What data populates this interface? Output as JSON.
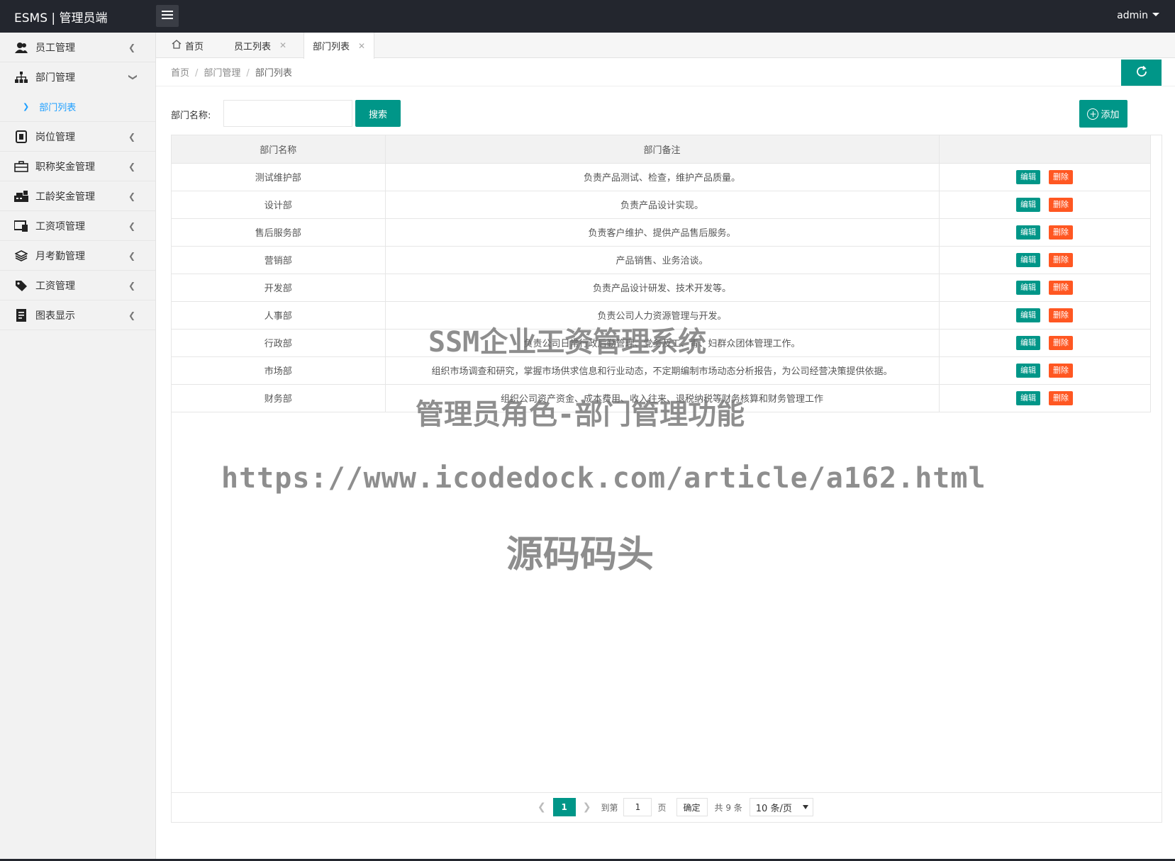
{
  "app": {
    "title": "ESMS | 管理员端",
    "user": "admin"
  },
  "sidebar": {
    "items": [
      {
        "label": "员工管理",
        "icon": "users-icon"
      },
      {
        "label": "部门管理",
        "icon": "org-tree-icon",
        "expanded": true,
        "children": [
          {
            "label": "部门列表",
            "active": true
          }
        ]
      },
      {
        "label": "岗位管理",
        "icon": "badge-icon"
      },
      {
        "label": "职称奖金管理",
        "icon": "briefcase-icon"
      },
      {
        "label": "工龄奖金管理",
        "icon": "cash-register-icon"
      },
      {
        "label": "工资项管理",
        "icon": "monitor-icon"
      },
      {
        "label": "月考勤管理",
        "icon": "layers-icon"
      },
      {
        "label": "工资管理",
        "icon": "tag-icon"
      },
      {
        "label": "图表显示",
        "icon": "receipt-icon"
      }
    ]
  },
  "tabs": [
    {
      "label": "首页",
      "icon": "home-icon",
      "closable": false
    },
    {
      "label": "员工列表",
      "closable": true
    },
    {
      "label": "部门列表",
      "closable": true,
      "active": true
    }
  ],
  "breadcrumb": [
    "首页",
    "部门管理",
    "部门列表"
  ],
  "search": {
    "label": "部门名称:",
    "value": "",
    "button": "搜索"
  },
  "add_button": "添加",
  "table": {
    "columns": [
      "部门名称",
      "部门备注",
      ""
    ],
    "rows": [
      {
        "name": "测试维护部",
        "remark": "负责产品测试、检查，维护产品质量。"
      },
      {
        "name": "设计部",
        "remark": "负责产品设计实现。"
      },
      {
        "name": "售后服务部",
        "remark": "负责客户维护、提供产品售后服务。"
      },
      {
        "name": "营销部",
        "remark": "产品销售、业务洽谈。"
      },
      {
        "name": "开发部",
        "remark": "负责产品设计研发、技术开发等。"
      },
      {
        "name": "人事部",
        "remark": "负责公司人力资源管理与开发。"
      },
      {
        "name": "行政部",
        "remark": "负责公司日常行政后勤管理、党务及工、青、妇群众团体管理工作。"
      },
      {
        "name": "市场部",
        "remark": "组织市场调查和研究，掌握市场供求信息和行业动态，不定期编制市场动态分析报告，为公司经营决策提供依据。"
      },
      {
        "name": "财务部",
        "remark": "组织公司资产资金、成本费用、收入往来、退税纳税等财务核算和财务管理工作"
      }
    ],
    "edit_label": "编辑",
    "delete_label": "删除"
  },
  "pagination": {
    "current_page": "1",
    "goto_label": "到第",
    "goto_value": "1",
    "page_unit": "页",
    "confirm": "确定",
    "total": "共 9 条",
    "page_size": "10 条/页"
  },
  "watermarks": {
    "line1": "SSM企业工资管理系统",
    "line2": "管理员角色-部门管理功能",
    "line3": "https://www.icodedock.com/article/a162.html",
    "line4": "源码码头"
  },
  "colors": {
    "topbar": "#23262e",
    "primary": "#009688",
    "danger": "#ff5722",
    "link": "#1e9fff"
  }
}
